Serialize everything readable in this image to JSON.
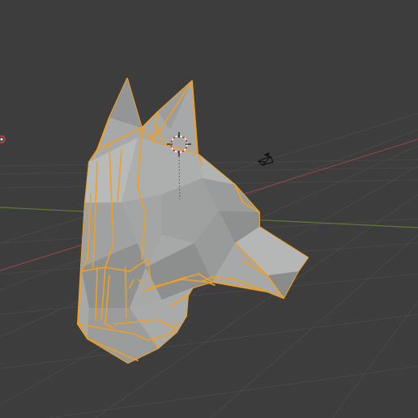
{
  "viewport": {
    "background": "#3d3d3d",
    "grid_color": "#484848",
    "x_axis_color": "#8a4545",
    "y_axis_color": "#5f7a38",
    "selection_outline_color": "#f0a020",
    "mesh_face_color": "#a7a8a8"
  },
  "objects": {
    "mesh": "dog-head-lowpoly-mesh",
    "selected": true,
    "camera": "camera-icon",
    "light": "light-icon",
    "origin": "3d-cursor"
  }
}
